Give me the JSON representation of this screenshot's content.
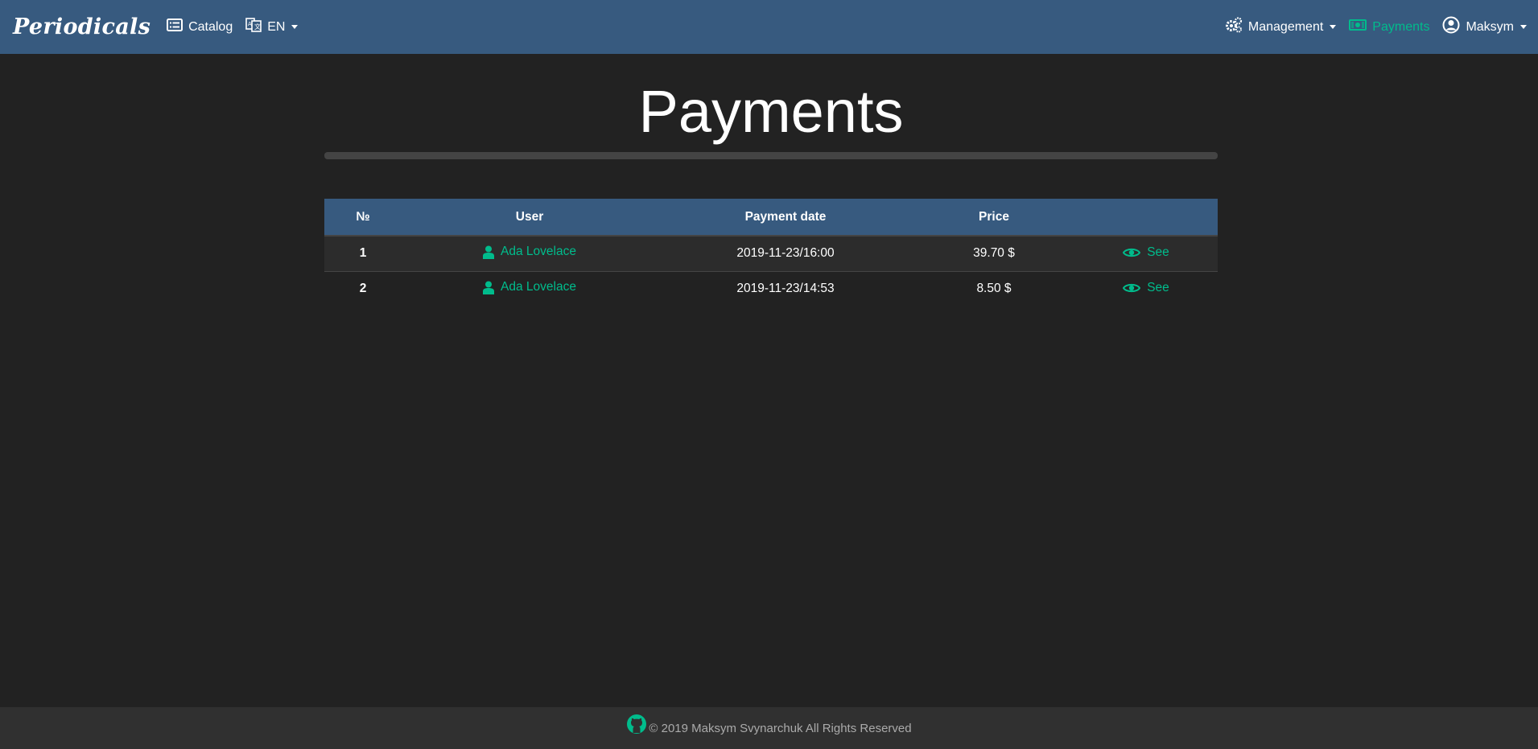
{
  "navbar": {
    "brand": "Periodicals",
    "catalog_label": "Catalog",
    "language_label": "EN",
    "management_label": "Management",
    "payments_label": "Payments",
    "user_label": "Maksym",
    "icons": {
      "catalog": "list-alt-icon",
      "language": "language-icon",
      "management": "gears-icon",
      "payments": "money-bill-icon",
      "user": "user-circle-icon"
    }
  },
  "page": {
    "title": "Payments"
  },
  "table": {
    "columns": [
      "№",
      "User",
      "Payment date",
      "Price",
      ""
    ],
    "rows": [
      {
        "num": "1",
        "user": "Ada Lovelace",
        "date": "2019-11-23/16:00",
        "price": "39.70 $",
        "action": "See"
      },
      {
        "num": "2",
        "user": "Ada Lovelace",
        "date": "2019-11-23/14:53",
        "price": "8.50 $",
        "action": "See"
      }
    ]
  },
  "footer": {
    "text": "© 2019 Maksym Svynarchuk All Rights Reserved",
    "icon": "github-icon"
  },
  "colors": {
    "navbar_bg": "#375a7f",
    "page_bg": "#222222",
    "accent": "#00bc8c",
    "footer_bg": "#303030"
  }
}
